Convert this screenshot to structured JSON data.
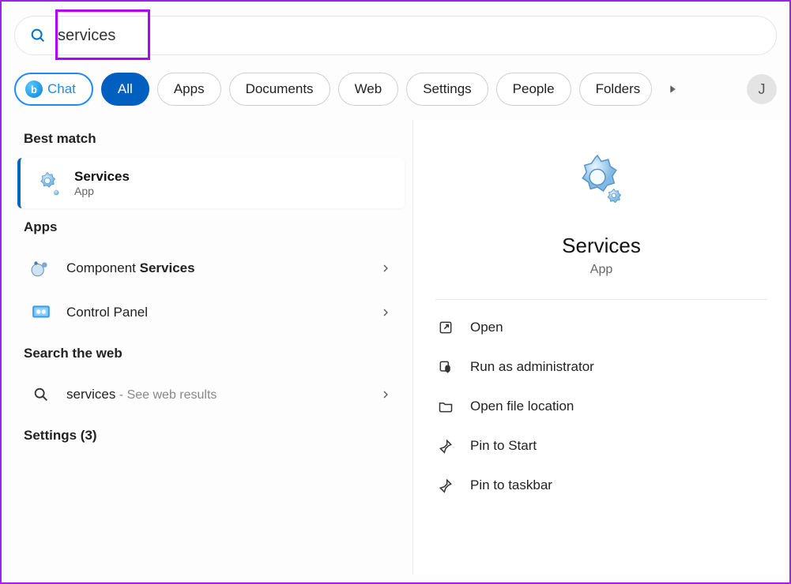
{
  "search": {
    "value": "services"
  },
  "filters": {
    "chat": "Chat",
    "items": [
      "All",
      "Apps",
      "Documents",
      "Web",
      "Settings",
      "People",
      "Folders"
    ],
    "active_index": 0
  },
  "avatar_initial": "J",
  "left": {
    "best_match_label": "Best match",
    "best": {
      "title": "Services",
      "subtitle": "App"
    },
    "apps_label": "Apps",
    "apps": [
      {
        "prefix": "Component ",
        "match": "Services"
      },
      {
        "label": "Control Panel"
      }
    ],
    "web_label": "Search the web",
    "web": {
      "query": "services",
      "suffix": " - See web results"
    },
    "settings_label": "Settings (3)"
  },
  "detail": {
    "title": "Services",
    "subtitle": "App",
    "actions": [
      {
        "id": "open",
        "label": "Open"
      },
      {
        "id": "run-admin",
        "label": "Run as administrator"
      },
      {
        "id": "open-location",
        "label": "Open file location"
      },
      {
        "id": "pin-start",
        "label": "Pin to Start"
      },
      {
        "id": "pin-taskbar",
        "label": "Pin to taskbar"
      }
    ]
  }
}
